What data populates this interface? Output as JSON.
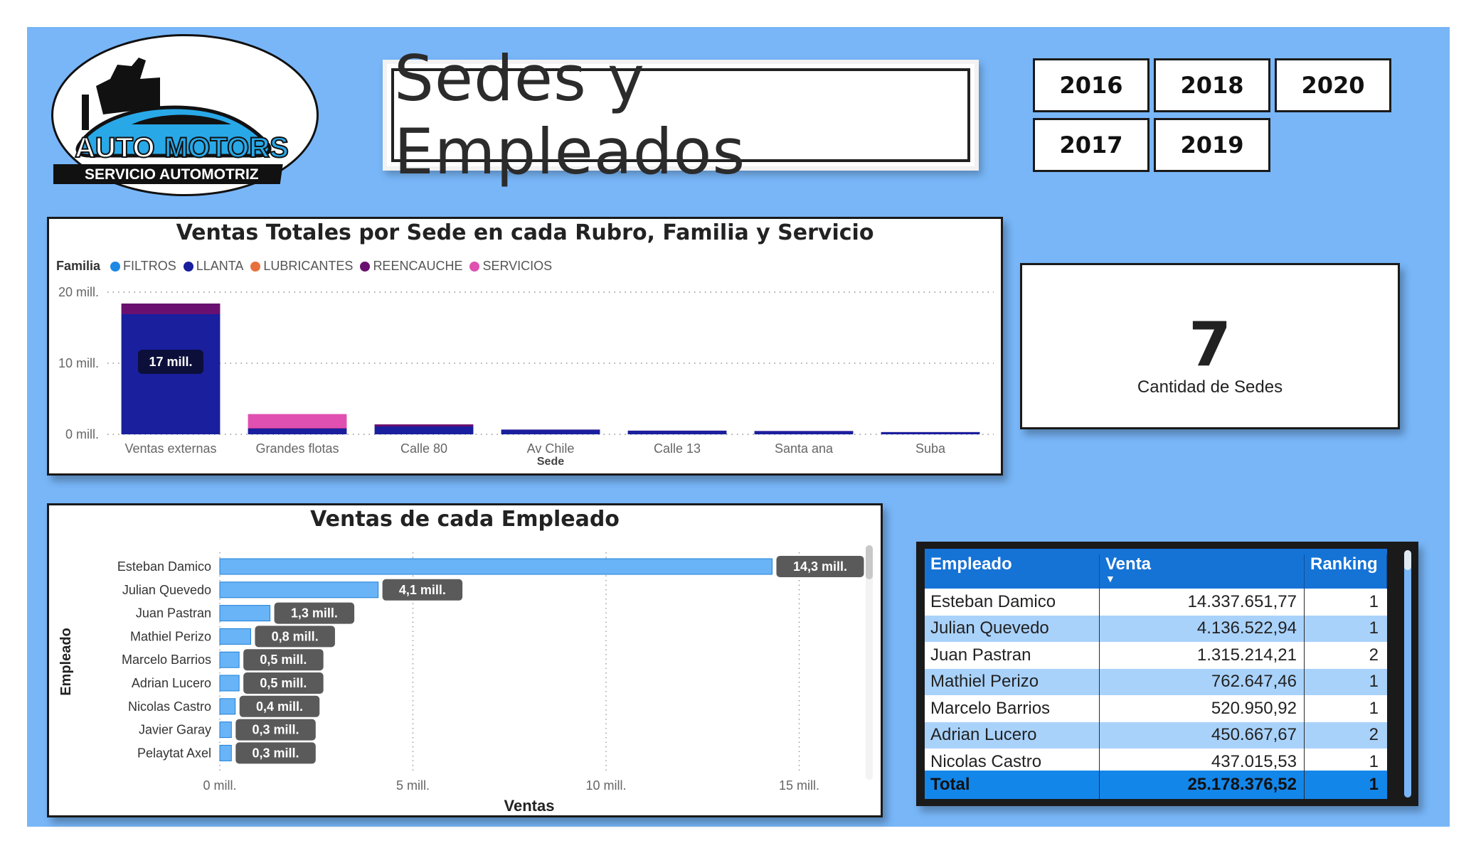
{
  "logo": {
    "brand_left": "AUTO",
    "brand_right": "MOTORS",
    "tagline": "SERVICIO AUTOMOTRIZ"
  },
  "header": {
    "title": "Sedes y Empleados"
  },
  "year_slicer": {
    "years": [
      "2016",
      "2018",
      "2020",
      "2017",
      "2019"
    ]
  },
  "kpi": {
    "value": "7",
    "label": "Cantidad de Sedes"
  },
  "colors": {
    "background": "#78b6f8",
    "filtros": "#1e88e5",
    "llanta": "#1a1f9e",
    "lubricantes": "#e8703c",
    "reencauche": "#6a1070",
    "servicios": "#e050b0",
    "employee_bar": "#69b4f6",
    "table_header": "#1673d6"
  },
  "chart_sede": {
    "title": "Ventas Totales por Sede en cada Rubro, Familia y Servicio",
    "legend_title": "Familia",
    "legend": [
      "FILTROS",
      "LLANTA",
      "LUBRICANTES",
      "REENCAUCHE",
      "SERVICIOS"
    ],
    "y_ticks": [
      "20 mill.",
      "10 mill.",
      "0 mill."
    ],
    "xlabel": "Sede",
    "bar_label": "17 mill."
  },
  "chart_empleado": {
    "title": "Ventas de cada Empleado",
    "ylabel": "Empleado",
    "xlabel": "Ventas",
    "x_ticks": [
      "0 mill.",
      "5 mill.",
      "10 mill.",
      "15 mill."
    ]
  },
  "chart_data": [
    {
      "type": "bar",
      "stacked": true,
      "title": "Ventas Totales por Sede en cada Rubro, Familia y Servicio",
      "xlabel": "Sede",
      "ylabel": "",
      "ylim": [
        0,
        20
      ],
      "unit": "mill.",
      "categories": [
        "Ventas externas",
        "Grandes flotas",
        "Calle 80",
        "Av Chile",
        "Calle 13",
        "Santa ana",
        "Suba"
      ],
      "series": [
        {
          "name": "FILTROS",
          "values": [
            0,
            0,
            0,
            0,
            0,
            0,
            0
          ]
        },
        {
          "name": "LLANTA",
          "values": [
            16.9,
            0.8,
            1.1,
            0.65,
            0.5,
            0.45,
            0.3
          ]
        },
        {
          "name": "LUBRICANTES",
          "values": [
            0,
            0,
            0,
            0,
            0,
            0,
            0
          ]
        },
        {
          "name": "REENCAUCHE",
          "values": [
            1.5,
            0.05,
            0.3,
            0.02,
            0.02,
            0.02,
            0.02
          ]
        },
        {
          "name": "SERVICIOS",
          "values": [
            0,
            2.0,
            0,
            0,
            0,
            0,
            0
          ]
        }
      ],
      "data_labels": [
        {
          "category": "Ventas externas",
          "series": "LLANTA",
          "text": "17 mill."
        }
      ],
      "grid": true,
      "legend_position": "top-left"
    },
    {
      "type": "bar",
      "orientation": "horizontal",
      "title": "Ventas de cada Empleado",
      "xlabel": "Ventas",
      "ylabel": "Empleado",
      "xlim": [
        0,
        16.5
      ],
      "unit": "mill.",
      "categories": [
        "Esteban Damico",
        "Julian Quevedo",
        "Juan Pastran",
        "Mathiel Perizo",
        "Marcelo Barrios",
        "Adrian Lucero",
        "Nicolas Castro",
        "Javier Garay",
        "Pelaytat Axel"
      ],
      "values": [
        14.3,
        4.1,
        1.3,
        0.8,
        0.5,
        0.5,
        0.4,
        0.3,
        0.3
      ],
      "value_labels": [
        "14,3 mill.",
        "4,1 mill.",
        "1,3 mill.",
        "0,8 mill.",
        "0,5 mill.",
        "0,5 mill.",
        "0,4 mill.",
        "0,3 mill.",
        "0,3 mill."
      ],
      "grid": true
    }
  ],
  "table": {
    "headers": [
      "Empleado",
      "Venta",
      "Ranking"
    ],
    "rows": [
      [
        "Esteban Damico",
        "14.337.651,77",
        "1"
      ],
      [
        "Julian Quevedo",
        "4.136.522,94",
        "1"
      ],
      [
        "Juan Pastran",
        "1.315.214,21",
        "2"
      ],
      [
        "Mathiel Perizo",
        "762.647,46",
        "1"
      ],
      [
        "Marcelo Barrios",
        "520.950,92",
        "1"
      ],
      [
        "Adrian Lucero",
        "450.667,67",
        "2"
      ],
      [
        "Nicolas Castro",
        "437.015,53",
        "1"
      ]
    ],
    "total": [
      "Total",
      "25.178.376,52",
      "1"
    ]
  }
}
